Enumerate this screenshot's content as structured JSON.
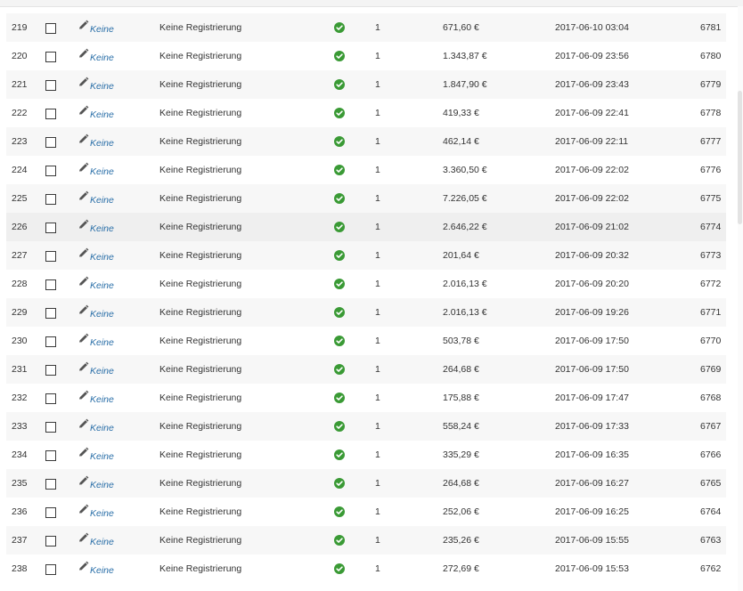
{
  "colors": {
    "row_odd": "#f7f7f7",
    "row_even": "#ffffff",
    "row_hover": "#efefef",
    "link": "#2a6fa8",
    "success": "#3a9a35"
  },
  "icons": {
    "edit": "pencil-icon",
    "status": "check-circle-icon"
  },
  "rows": [
    {
      "num": "219",
      "link": "Keine",
      "registration": "Keine Registrierung",
      "qty": "1",
      "amount": "671,60 €",
      "date": "2017-06-10 03:04",
      "id": "6781"
    },
    {
      "num": "220",
      "link": "Keine",
      "registration": "Keine Registrierung",
      "qty": "1",
      "amount": "1.343,87 €",
      "date": "2017-06-09 23:56",
      "id": "6780"
    },
    {
      "num": "221",
      "link": "Keine",
      "registration": "Keine Registrierung",
      "qty": "1",
      "amount": "1.847,90 €",
      "date": "2017-06-09 23:43",
      "id": "6779"
    },
    {
      "num": "222",
      "link": "Keine",
      "registration": "Keine Registrierung",
      "qty": "1",
      "amount": "419,33 €",
      "date": "2017-06-09 22:41",
      "id": "6778"
    },
    {
      "num": "223",
      "link": "Keine",
      "registration": "Keine Registrierung",
      "qty": "1",
      "amount": "462,14 €",
      "date": "2017-06-09 22:11",
      "id": "6777"
    },
    {
      "num": "224",
      "link": "Keine",
      "registration": "Keine Registrierung",
      "qty": "1",
      "amount": "3.360,50 €",
      "date": "2017-06-09 22:02",
      "id": "6776"
    },
    {
      "num": "225",
      "link": "Keine",
      "registration": "Keine Registrierung",
      "qty": "1",
      "amount": "7.226,05 €",
      "date": "2017-06-09 22:02",
      "id": "6775"
    },
    {
      "num": "226",
      "link": "Keine",
      "registration": "Keine Registrierung",
      "qty": "1",
      "amount": "2.646,22 €",
      "date": "2017-06-09 21:02",
      "id": "6774",
      "hover": true
    },
    {
      "num": "227",
      "link": "Keine",
      "registration": "Keine Registrierung",
      "qty": "1",
      "amount": "201,64 €",
      "date": "2017-06-09 20:32",
      "id": "6773"
    },
    {
      "num": "228",
      "link": "Keine",
      "registration": "Keine Registrierung",
      "qty": "1",
      "amount": "2.016,13 €",
      "date": "2017-06-09 20:20",
      "id": "6772"
    },
    {
      "num": "229",
      "link": "Keine",
      "registration": "Keine Registrierung",
      "qty": "1",
      "amount": "2.016,13 €",
      "date": "2017-06-09 19:26",
      "id": "6771"
    },
    {
      "num": "230",
      "link": "Keine",
      "registration": "Keine Registrierung",
      "qty": "1",
      "amount": "503,78 €",
      "date": "2017-06-09 17:50",
      "id": "6770"
    },
    {
      "num": "231",
      "link": "Keine",
      "registration": "Keine Registrierung",
      "qty": "1",
      "amount": "264,68 €",
      "date": "2017-06-09 17:50",
      "id": "6769"
    },
    {
      "num": "232",
      "link": "Keine",
      "registration": "Keine Registrierung",
      "qty": "1",
      "amount": "175,88 €",
      "date": "2017-06-09 17:47",
      "id": "6768"
    },
    {
      "num": "233",
      "link": "Keine",
      "registration": "Keine Registrierung",
      "qty": "1",
      "amount": "558,24 €",
      "date": "2017-06-09 17:33",
      "id": "6767"
    },
    {
      "num": "234",
      "link": "Keine",
      "registration": "Keine Registrierung",
      "qty": "1",
      "amount": "335,29 €",
      "date": "2017-06-09 16:35",
      "id": "6766"
    },
    {
      "num": "235",
      "link": "Keine",
      "registration": "Keine Registrierung",
      "qty": "1",
      "amount": "264,68 €",
      "date": "2017-06-09 16:27",
      "id": "6765"
    },
    {
      "num": "236",
      "link": "Keine",
      "registration": "Keine Registrierung",
      "qty": "1",
      "amount": "252,06 €",
      "date": "2017-06-09 16:25",
      "id": "6764"
    },
    {
      "num": "237",
      "link": "Keine",
      "registration": "Keine Registrierung",
      "qty": "1",
      "amount": "235,26 €",
      "date": "2017-06-09 15:55",
      "id": "6763"
    },
    {
      "num": "238",
      "link": "Keine",
      "registration": "Keine Registrierung",
      "qty": "1",
      "amount": "272,69 €",
      "date": "2017-06-09 15:53",
      "id": "6762"
    }
  ]
}
